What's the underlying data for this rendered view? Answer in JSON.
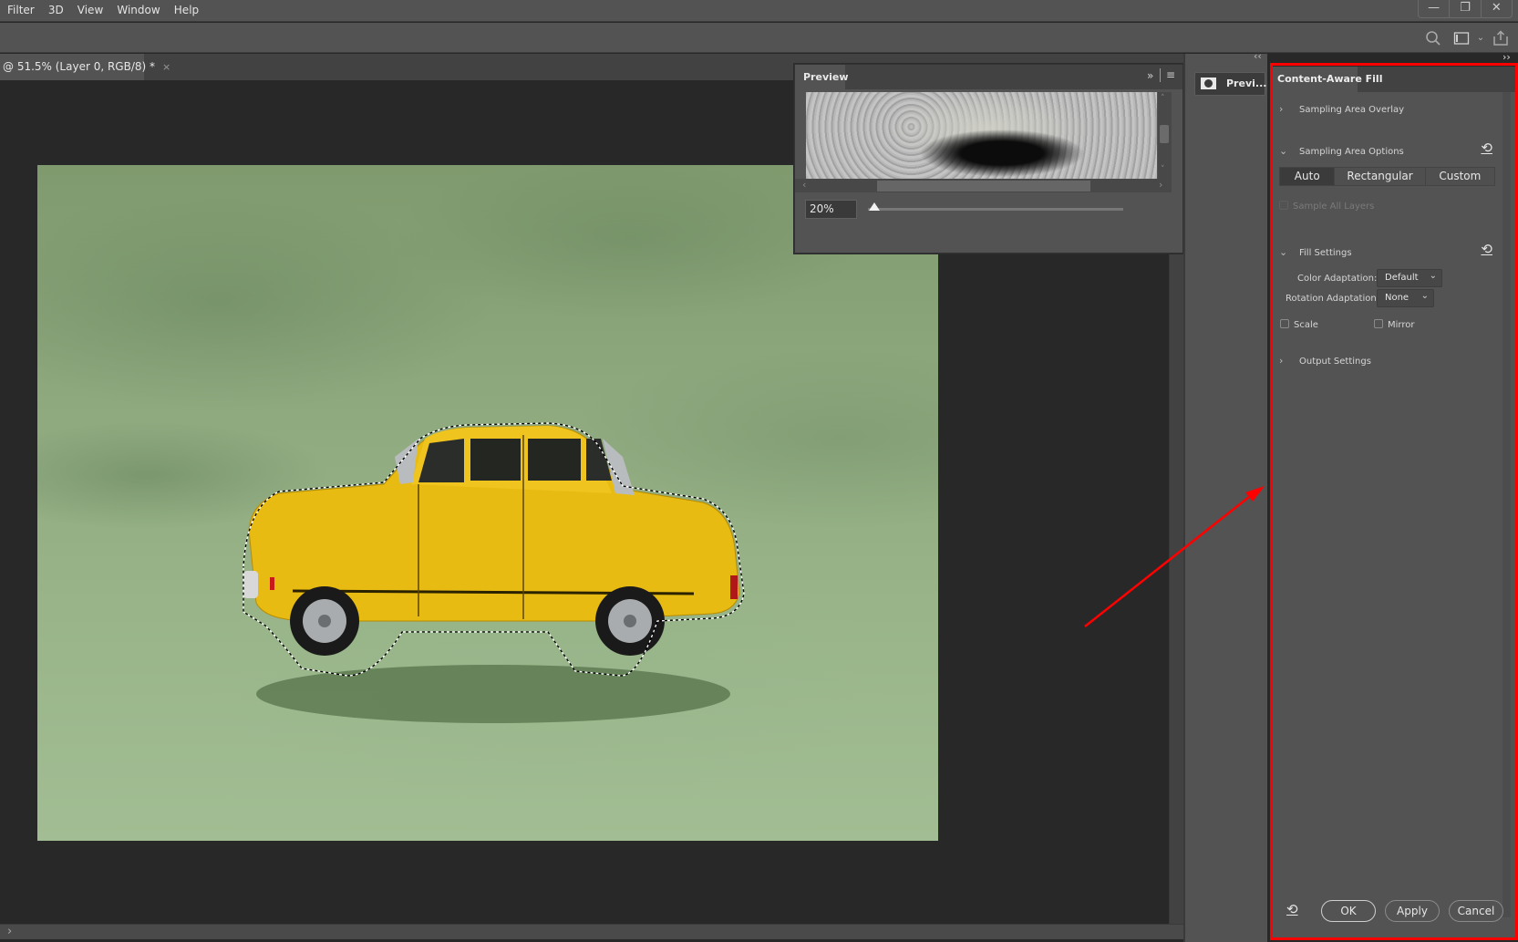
{
  "menubar": {
    "items": [
      "Filter",
      "3D",
      "View",
      "Window",
      "Help"
    ],
    "window_controls": {
      "minimize": "—",
      "restore": "❐",
      "close": "✕"
    }
  },
  "optionsbar": {
    "icons": [
      "search-icon",
      "workspace-icon",
      "chevron-down-icon",
      "share-icon"
    ]
  },
  "document": {
    "tab_label": "@ 51.5% (Layer 0, RGB/8) *",
    "close_glyph": "×"
  },
  "preview_panel": {
    "tab": "Preview",
    "zoom_value": "20%",
    "zoom_percent": 20
  },
  "dock": {
    "preview_button": "Previ...",
    "collapse_left": "‹‹",
    "collapse_right": "››"
  },
  "content_aware_fill": {
    "tab": "Content-Aware Fill",
    "sections": {
      "sampling_overlay": {
        "label": "Sampling Area Overlay",
        "expanded": false
      },
      "sampling_options": {
        "label": "Sampling Area Options",
        "expanded": true
      },
      "fill_settings": {
        "label": "Fill Settings",
        "expanded": true
      },
      "output_settings": {
        "label": "Output Settings",
        "expanded": false
      }
    },
    "sampling_modes": [
      {
        "label": "Auto",
        "selected": true
      },
      {
        "label": "Rectangular",
        "selected": false
      },
      {
        "label": "Custom",
        "selected": false
      }
    ],
    "sample_all_layers": {
      "label": "Sample All Layers",
      "checked": false,
      "disabled": true
    },
    "color_adaptation": {
      "label": "Color Adaptation:",
      "value": "Default"
    },
    "rotation_adaptation": {
      "label": "Rotation Adaptation:",
      "value": "None"
    },
    "scale": {
      "label": "Scale",
      "checked": false
    },
    "mirror": {
      "label": "Mirror",
      "checked": false
    },
    "buttons": {
      "ok": "OK",
      "apply": "Apply",
      "cancel": "Cancel"
    }
  },
  "annotation": {
    "highlight_color": "#ff0000"
  }
}
